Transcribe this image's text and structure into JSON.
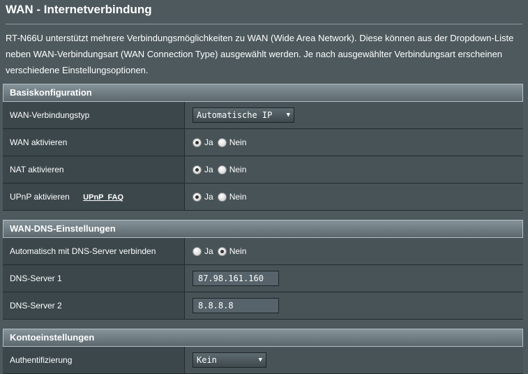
{
  "page": {
    "title": "WAN - Internetverbindung",
    "description": "RT-N66U unterstützt mehrere Verbindungsmöglichkeiten zu WAN (Wide Area Network). Diese können aus der Dropdown-Liste neben WAN-Verbindungsart (WAN Connection Type) ausgewählt werden. Je nach ausgewählter Verbindungsart erscheinen verschiedene Einstellungsoptionen."
  },
  "basic": {
    "header": "Basiskonfiguration",
    "wan_type": {
      "label": "WAN-Verbindungstyp",
      "value": "Automatische IP"
    },
    "wan_enable": {
      "label": "WAN aktivieren",
      "yes": "Ja",
      "no": "Nein",
      "selected": "yes"
    },
    "nat_enable": {
      "label": "NAT aktivieren",
      "yes": "Ja",
      "no": "Nein",
      "selected": "yes"
    },
    "upnp_enable": {
      "label": "UPnP aktivieren",
      "faq": "UPnP  FAQ",
      "yes": "Ja",
      "no": "Nein",
      "selected": "yes"
    }
  },
  "dns": {
    "header": "WAN-DNS-Einstellungen",
    "auto": {
      "label": "Automatisch mit DNS-Server verbinden",
      "yes": "Ja",
      "no": "Nein",
      "selected": "no"
    },
    "server1": {
      "label": "DNS-Server 1",
      "value": "87.98.161.160"
    },
    "server2": {
      "label": "DNS-Server 2",
      "value": "8.8.8.8"
    }
  },
  "account": {
    "header": "Kontoeinstellungen",
    "auth": {
      "label": "Authentifizierung",
      "value": "Kein"
    }
  }
}
